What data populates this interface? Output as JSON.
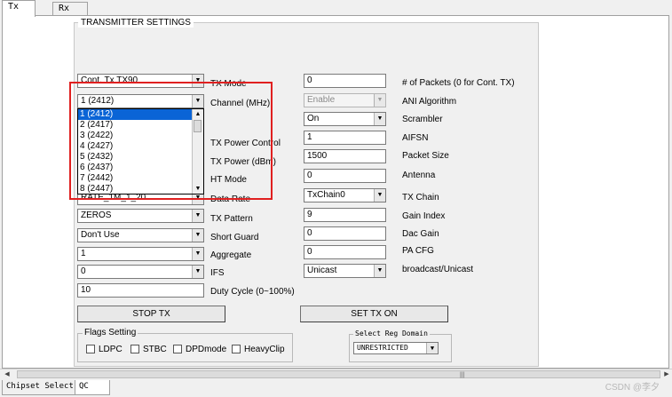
{
  "tabs_top": [
    "Tx",
    "Rx"
  ],
  "group_title": "TRANSMITTER SETTINGS",
  "left_combos": {
    "mode": "Cont. Tx TX90",
    "channel": "1 (2412)",
    "rate": "RATE_1M_1_20",
    "pattern": "ZEROS",
    "guard": "Don't Use",
    "aggregate": "1",
    "ifs": "0"
  },
  "duty_cycle_value": "10",
  "channel_options": [
    "1 (2412)",
    "2 (2417)",
    "3 (2422)",
    "4 (2427)",
    "5 (2432)",
    "6 (2437)",
    "7 (2442)",
    "8 (2447)"
  ],
  "labels_mid": {
    "tx_mode": "TX Mode",
    "channel": "Channel (MHz)",
    "tx_power_control": "TX Power Control",
    "tx_power": "TX Power (dBm)",
    "ht_mode": "HT Mode",
    "data_rate": "Data Rate",
    "tx_pattern": "TX Pattern",
    "short_guard": "Short Guard",
    "aggregate": "Aggregate",
    "ifs": "IFS",
    "duty_cycle": "Duty Cycle (0~100%)"
  },
  "right_fields": {
    "packets": "0",
    "ani": "Enable",
    "scrambler": "On",
    "aifsn": "1",
    "packet_size": "1500",
    "antenna": "0",
    "tx_chain": "TxChain0",
    "gain_index": "9",
    "dac_gain": "0",
    "pa_cfg": "0",
    "cast": "Unicast"
  },
  "labels_right": {
    "packets": "# of Packets (0 for Cont. TX)",
    "ani": "ANI Algorithm",
    "scrambler": "Scrambler",
    "aifsn": "AIFSN",
    "packet_size": "Packet Size",
    "antenna": "Antenna",
    "tx_chain": "TX Chain",
    "gain_index": "Gain Index",
    "dac_gain": "Dac Gain",
    "pa_cfg": "PA CFG",
    "cast": "broadcast/Unicast"
  },
  "buttons": {
    "stop": "STOP TX",
    "set": "SET TX ON"
  },
  "flags": {
    "title": "Flags Setting",
    "items": [
      "LDPC",
      "STBC",
      "DPDmode",
      "HeavyClip"
    ]
  },
  "reg_domain": {
    "title": "Select Reg Domain",
    "value": "UNRESTRICTED"
  },
  "bottom_tabs": [
    "Chipset Select",
    "QC"
  ],
  "watermark": "CSDN @李夕",
  "colors": {
    "highlight": "#0a64d6",
    "annotation_box": "#e02020"
  }
}
